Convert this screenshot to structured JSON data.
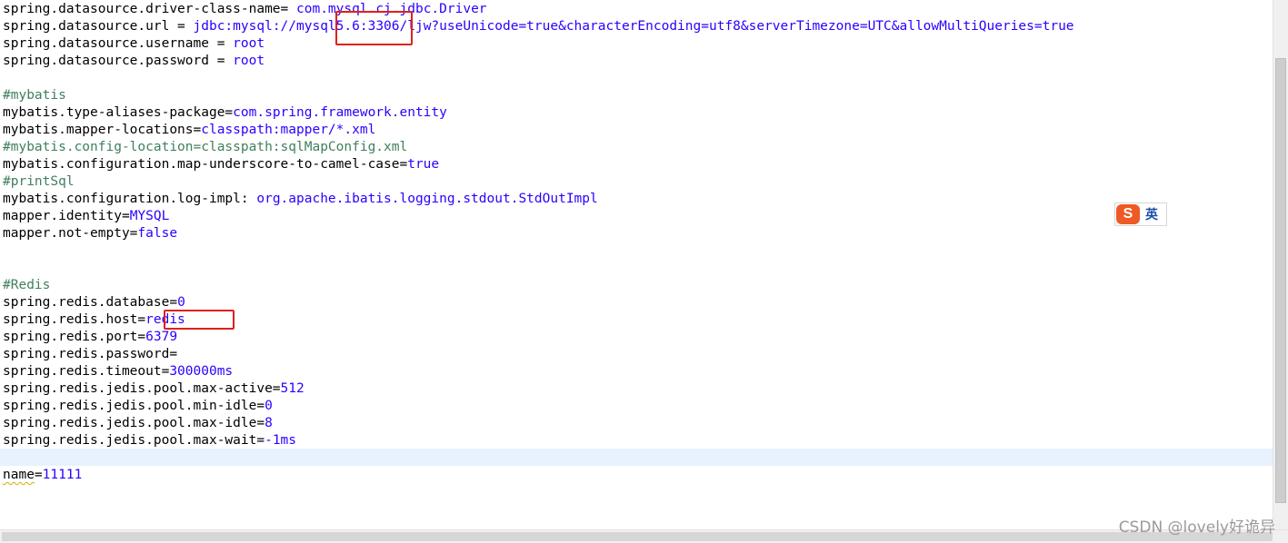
{
  "editor": {
    "l1": {
      "key": "spring.datasource.driver-class-name= ",
      "value": "com.mysql.cj.jdbc.Driver"
    },
    "l2": {
      "key": "spring.datasource.url = ",
      "value_a": "jdbc:mysql://",
      "value_b": "mysql5.6",
      "value_c": ":3306/ljw?useUnicode=true&characterEncoding=utf8&serverTimezone=UTC&allowMultiQueries=true"
    },
    "l3": {
      "key": "spring.datasource.username = ",
      "value": "root"
    },
    "l4": {
      "key": "spring.datasource.password = ",
      "value": "root"
    },
    "l6": {
      "comment": "#mybatis"
    },
    "l7": {
      "key": "mybatis.type-aliases-package=",
      "value": "com.spring.framework.entity"
    },
    "l8": {
      "key": "mybatis.mapper-locations=",
      "value": "classpath:mapper/*.xml"
    },
    "l9": {
      "comment": "#mybatis.config-location=classpath:sqlMapConfig.xml"
    },
    "l10": {
      "key": "mybatis.configuration.map-underscore-to-camel-case=",
      "value": "true"
    },
    "l11": {
      "comment": "#printSql"
    },
    "l12": {
      "key": "mybatis.configuration.log-impl: ",
      "value": "org.apache.ibatis.logging.stdout.StdOutImpl"
    },
    "l13": {
      "key": "mapper.identity=",
      "value": "MYSQL"
    },
    "l14": {
      "key": "mapper.not-empty=",
      "value": "false"
    },
    "l17": {
      "comment": "#Redis"
    },
    "l18": {
      "key": "spring.redis.database=",
      "value": "0"
    },
    "l19": {
      "key": "spring.redis.host=",
      "value": "redis"
    },
    "l20": {
      "key": "spring.redis.port=",
      "value": "6379"
    },
    "l21": {
      "key": "spring.redis.password=",
      "value": ""
    },
    "l22": {
      "key": "spring.redis.timeout=",
      "value": "300000ms"
    },
    "l23": {
      "key": "spring.redis.jedis.pool.max-active=",
      "value": "512"
    },
    "l24": {
      "key": "spring.redis.jedis.pool.min-idle=",
      "value": "0"
    },
    "l25": {
      "key": "spring.redis.jedis.pool.max-idle=",
      "value": "8"
    },
    "l26": {
      "key": "spring.redis.jedis.pool.max-wait=",
      "value": "-1ms"
    },
    "l28": {
      "key": "name",
      "eq": "=",
      "value": "11111"
    }
  },
  "ime": {
    "logo": "S",
    "mode": "英"
  },
  "watermark": "CSDN @lovely好诡异",
  "colors": {
    "key": "#000000",
    "value": "#2a00ff",
    "comment": "#3f7f5f",
    "current_line": "#e8f2fe",
    "highlight_box": "#e0201a"
  }
}
